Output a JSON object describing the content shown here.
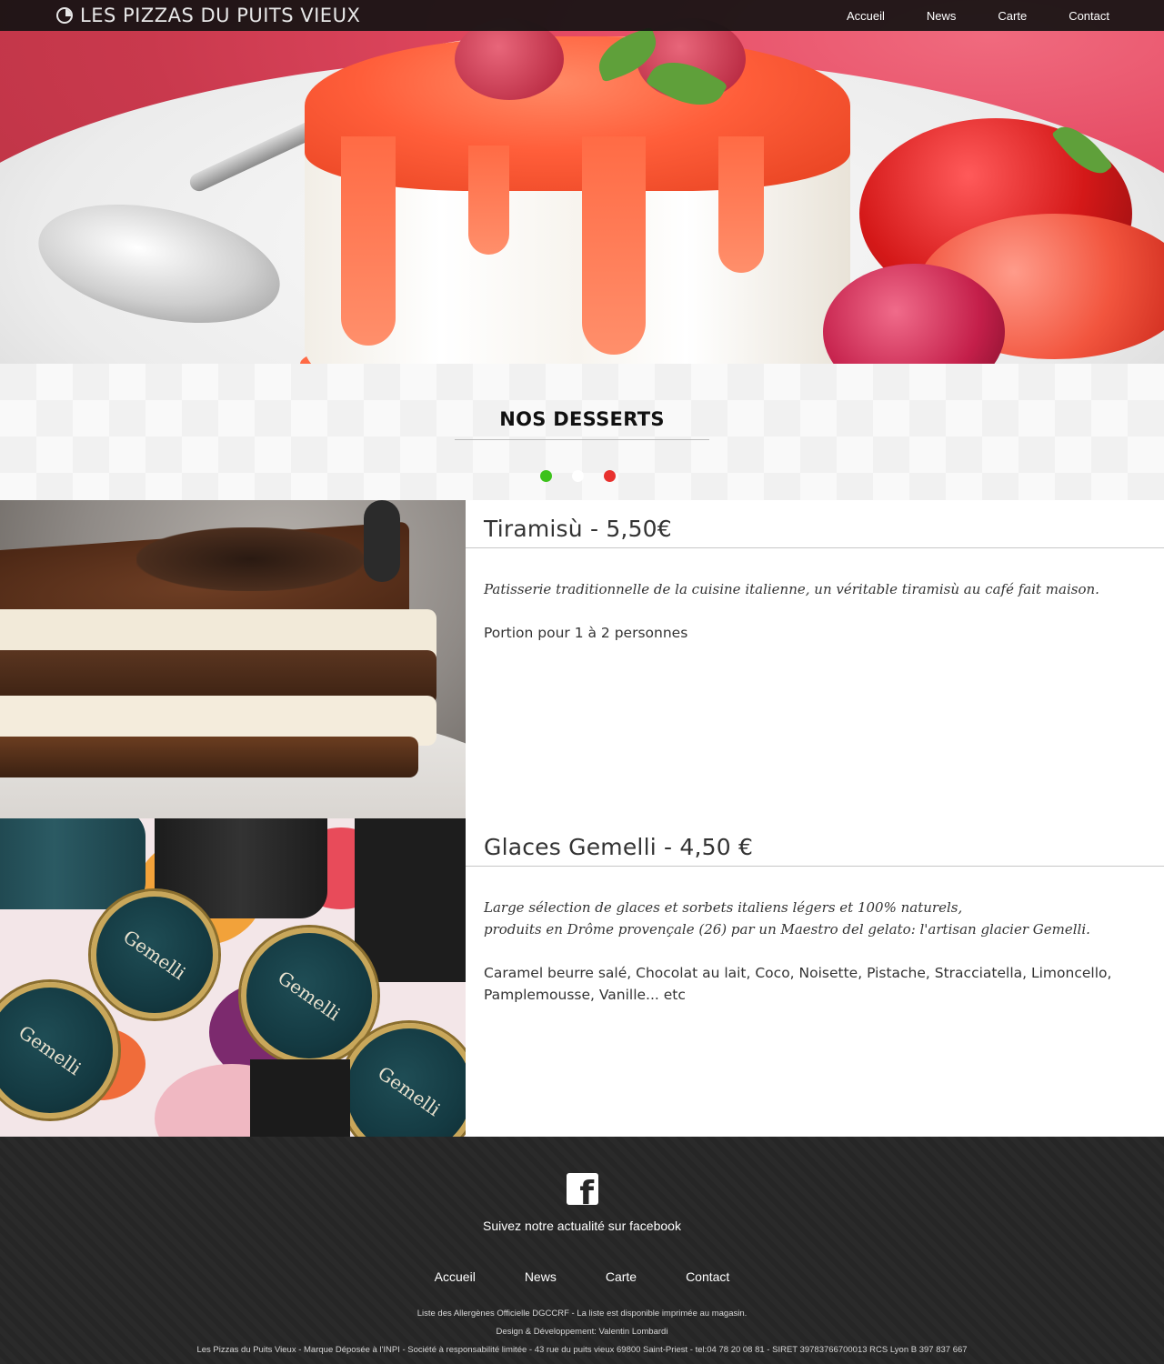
{
  "header": {
    "brand": "LES PIZZAS DU PUITS VIEUX",
    "nav": [
      "Accueil",
      "News",
      "Carte",
      "Contact"
    ]
  },
  "section": {
    "title": "NOS DESSERTS",
    "dot_colors": [
      "#3dc21b",
      "#ffffff",
      "#e8312e"
    ]
  },
  "items": [
    {
      "title": "Tiramisù - 5,50€",
      "description": [
        "Patisserie traditionnelle de la cuisine italienne, un véritable tiramisù au café fait maison."
      ],
      "extra": "Portion pour 1 à 2 personnes"
    },
    {
      "title": "Glaces Gemelli - 4,50 €",
      "description": [
        "Large sélection de glaces et sorbets italiens légers et 100% naturels,",
        "produits en Drôme provençale (26) par un Maestro del gelato: l'artisan glacier Gemelli."
      ],
      "extra": "Caramel beurre salé, Chocolat au lait, Coco, Noisette, Pistache, Stracciatella, Limoncello, Pamplemousse, Vanille... etc"
    }
  ],
  "footer": {
    "facebook_text": "Suivez notre actualité sur facebook",
    "nav": [
      "Accueil",
      "News",
      "Carte",
      "Contact"
    ],
    "legal": [
      "Liste des Allergènes Officielle DGCCRF - La liste est disponible imprimée au magasin.",
      "Design & Développement: Valentin Lombardi",
      "Les Pizzas du Puits Vieux - Marque Déposée à l'INPI - Société à responsabilité limitée - 43 rue du puits vieux 69800 Saint-Priest - tel:04 78 20 08 81 - SIRET 39783766700013 RCS Lyon B 397 837 667"
    ]
  },
  "icons": {
    "brand_logo": "circle-logo-icon",
    "facebook": "facebook-icon"
  },
  "images": {
    "hero": "panna-cotta-with-strawberries-photo",
    "item_0": "tiramisu-photo",
    "item_1": "gemelli-ice-cream-tins-photo"
  }
}
